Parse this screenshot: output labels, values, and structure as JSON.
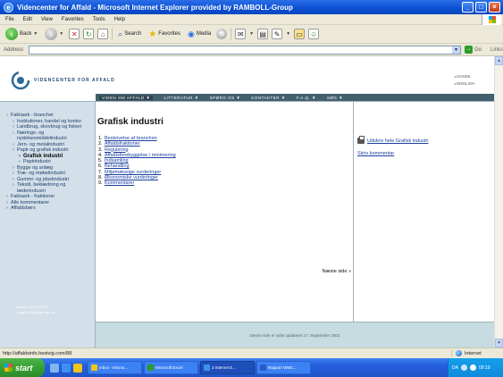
{
  "window": {
    "title": "Videncenter for Affald - Microsoft Internet Explorer provided by RAMBOLL-Group",
    "buttons": [
      "_",
      "□",
      "×"
    ]
  },
  "menu": [
    "File",
    "Edit",
    "View",
    "Favorites",
    "Tools",
    "Help"
  ],
  "toolbar": {
    "back": "Back",
    "search": "Search",
    "favorites": "Favorites",
    "media": "Media"
  },
  "address": {
    "label": "Address",
    "value": "",
    "go": "Go",
    "links": "Links"
  },
  "site": {
    "logo_text": "VIDENCENTER FOR AFFALD",
    "languages": [
      "DANSK",
      "ENGLISH"
    ],
    "nav": [
      "VIDEN OM AFFALD ▼",
      "LITTERATUR ▼",
      "SPØRG OS ▼",
      "KONTAKTER ▼",
      "F.A.Q. ▼",
      "SØG ▼"
    ],
    "sidebar": [
      {
        "label": "Faktaark - brancher",
        "level": 1
      },
      {
        "label": "Institutioner, handel og kontor",
        "level": 2
      },
      {
        "label": "Landbrug, skovbrug og fiskeri",
        "level": 2
      },
      {
        "label": "Nærings- og nydelsesmiddelindustri",
        "level": 2
      },
      {
        "label": "Jern- og metalindustri",
        "level": 2
      },
      {
        "label": "Papir og grafisk industri",
        "level": 2
      },
      {
        "label": "Grafisk industri",
        "level": 3,
        "current": true
      },
      {
        "label": "Papirindustri",
        "level": 3
      },
      {
        "label": "Bygge og anlæg",
        "level": 2
      },
      {
        "label": "Træ- og møbelindustri",
        "level": 2
      },
      {
        "label": "Gummi- og plastindustri",
        "level": 2
      },
      {
        "label": "Tekstil, beklædning og læderindustri",
        "level": 2
      },
      {
        "label": "Faktaark - fraktioner",
        "level": 1
      },
      {
        "label": "Alle kommentarer",
        "level": 1
      },
      {
        "label": "Affaldsbørs",
        "level": 1
      }
    ],
    "contact": [
      "Telefon: 39 31 39 30",
      "E-mail: info@wmc-net.dk"
    ],
    "heading": "Grafisk industri",
    "toc": [
      "Beskrivelse af branchen",
      "Affaldsfraktioner",
      "Regulering",
      "Affaldsforebyggelse / minimering",
      "Indsamling",
      "Behandling",
      "Miljømæssige vurderinger",
      "Økonomiske vurderinger",
      "Kommentarer"
    ],
    "next": "Næste side »",
    "print": "Udskriv hele Grafisk industri",
    "comment": "Skriv kommentar",
    "footer": "Denne side er sidst opdateret 17. September 2002"
  },
  "status": {
    "url": "http://affaldsinfo.hestvig.com/88",
    "zone": "Internet"
  },
  "taskbar": {
    "start": "start",
    "tasks": [
      {
        "label": "Inbox - Micros...",
        "color": "#f0c419"
      },
      {
        "label": "Microsoft Excel",
        "color": "#2e9c2a"
      },
      {
        "label": "3 Internet E...",
        "color": "#3e8ff5"
      },
      {
        "label": "Rapport WMC...",
        "color": "#2b58c9"
      }
    ],
    "tray_lang": "DA",
    "clock": "09:19"
  }
}
